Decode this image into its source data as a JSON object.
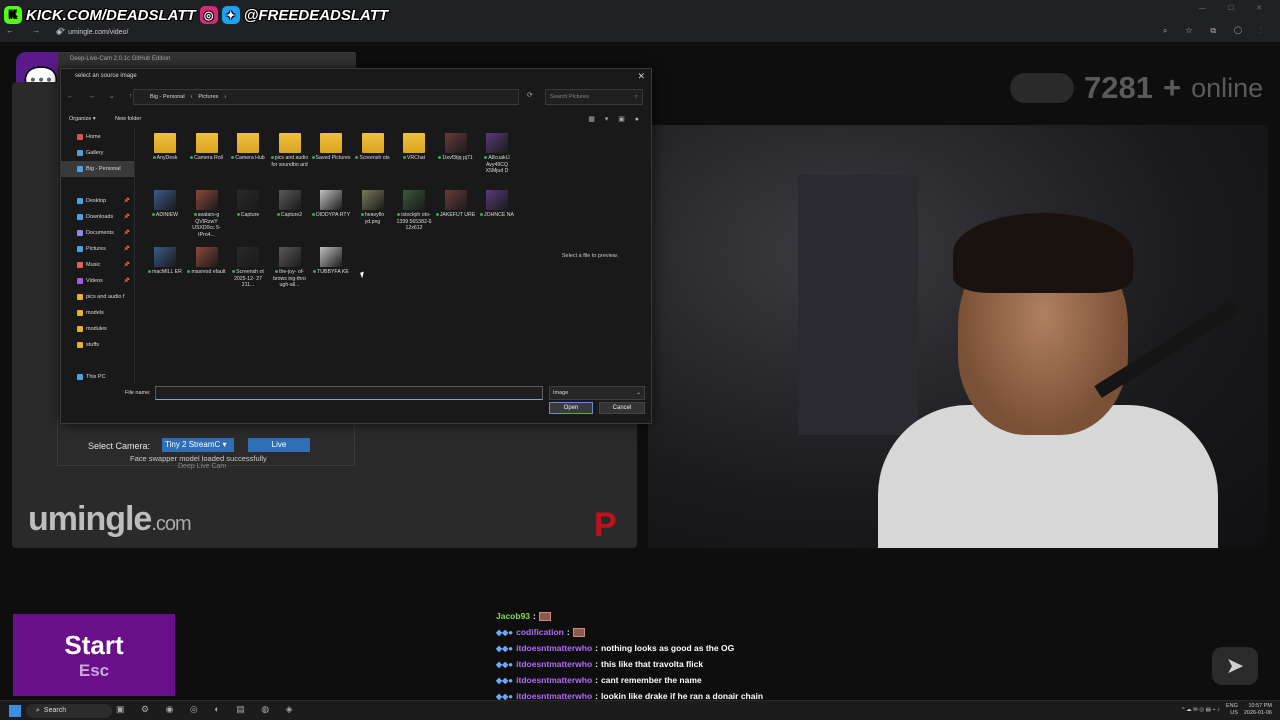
{
  "overlay": {
    "kick_handle": "KICK.COM/DEADSLATT",
    "social_handle": "@FREEDEADSLATT"
  },
  "browser": {
    "url": "umingle.com/video/"
  },
  "site": {
    "brand_name": "umingle",
    "brand_tld": ".com",
    "online_count": "7281",
    "online_plus": "+",
    "online_label": "online",
    "start_label": "Start",
    "start_sub": "Esc",
    "accent_purple": "#6a0f8a"
  },
  "chat": {
    "messages": [
      {
        "user": "Jacob93",
        "text": ""
      },
      {
        "user": "codification",
        "text": ""
      },
      {
        "user": "itdoesntmatterwho",
        "text": "nothing looks as good as the OG"
      },
      {
        "user": "itdoesntmatterwho",
        "text": "this like that travolta flick"
      },
      {
        "user": "itdoesntmatterwho",
        "text": "cant remember the name"
      },
      {
        "user": "itdoesntmatterwho",
        "text": "lookin like drake if he ran a donair chain"
      },
      {
        "user": "itdoesntmatterwho",
        "text": ""
      }
    ]
  },
  "deep_live_cam": {
    "title": "Deep-Live-Cam 2.0.1c GitHub Edition",
    "select_camera_label": "Select Camera:",
    "camera_value": "Tiny 2 StreamC",
    "live_label": "Live",
    "status": "Face swapper model loaded successfully",
    "footer": "Deep Live Cam"
  },
  "dialog": {
    "title": "select an source image",
    "path": [
      "Big - Personal",
      "Pictures"
    ],
    "search_placeholder": "Search Pictures",
    "organize_label": "Organize",
    "new_folder_label": "New folder",
    "nav": [
      {
        "label": "Home",
        "color": "#d9534f"
      },
      {
        "label": "Gallery",
        "color": "#5b9bd5"
      },
      {
        "label": "Big - Personal",
        "color": "#4aa3df"
      },
      {
        "label": "Desktop",
        "color": "#4aa3df"
      },
      {
        "label": "Downloads",
        "color": "#4aa3df"
      },
      {
        "label": "Documents",
        "color": "#8a8ae0"
      },
      {
        "label": "Pictures",
        "color": "#4aa3df"
      },
      {
        "label": "Music",
        "color": "#e06060"
      },
      {
        "label": "Videos",
        "color": "#a060e0"
      },
      {
        "label": "pics and audio f",
        "color": "#e8b030"
      },
      {
        "label": "models",
        "color": "#e8b030"
      },
      {
        "label": "modules",
        "color": "#e8b030"
      },
      {
        "label": "stuffs",
        "color": "#e8b030"
      },
      {
        "label": "This PC",
        "color": "#4aa3df"
      }
    ],
    "files": [
      {
        "name": "AnyDesk",
        "kind": "folder"
      },
      {
        "name": "Camera Roll",
        "kind": "folder"
      },
      {
        "name": "Camera Hub",
        "kind": "folder"
      },
      {
        "name": "pics and audio for soundbo ard",
        "kind": "folder"
      },
      {
        "name": "Saved Pictures",
        "kind": "folder"
      },
      {
        "name": "Screensh ots",
        "kind": "folder"
      },
      {
        "name": "VRChat",
        "kind": "folder"
      },
      {
        "name": "1txvf3tjq pj71",
        "kind": "image"
      },
      {
        "name": "A8cuakIJ Avy49CQ X5Mjud D",
        "kind": "image"
      },
      {
        "name": "ADINIEW",
        "kind": "image"
      },
      {
        "name": "avatars-g QVIRzwY USXD0cc 5-tPrn4...",
        "kind": "image"
      },
      {
        "name": "Capture",
        "kind": "image"
      },
      {
        "name": "Capture2",
        "kind": "image"
      },
      {
        "name": "DIDDYPA RTY",
        "kind": "image"
      },
      {
        "name": "heavyflo yd.png",
        "kind": "image"
      },
      {
        "name": "istockph oto-1399 565382-6 12x612",
        "kind": "image"
      },
      {
        "name": "JAKEFUT URE",
        "kind": "image"
      },
      {
        "name": "JOHNCE NA",
        "kind": "image"
      },
      {
        "name": "macMILL ER",
        "kind": "image"
      },
      {
        "name": "maxresd efault",
        "kind": "image"
      },
      {
        "name": "Screensh ot 2025-12- 27 211...",
        "kind": "image"
      },
      {
        "name": "the-joy- of-brows ing-thro ugh-all...",
        "kind": "image"
      },
      {
        "name": "TUBBYFA KE",
        "kind": "image"
      }
    ],
    "preview_text": "Select a file to preview.",
    "file_name_label": "File name:",
    "file_name_value": "",
    "file_type": "Image",
    "open_label": "Open",
    "cancel_label": "Cancel"
  },
  "taskbar": {
    "search_label": "Search",
    "lang_top": "ENG",
    "lang_bottom": "US",
    "time": "10:57 PM",
    "date": "2026-01-06"
  }
}
